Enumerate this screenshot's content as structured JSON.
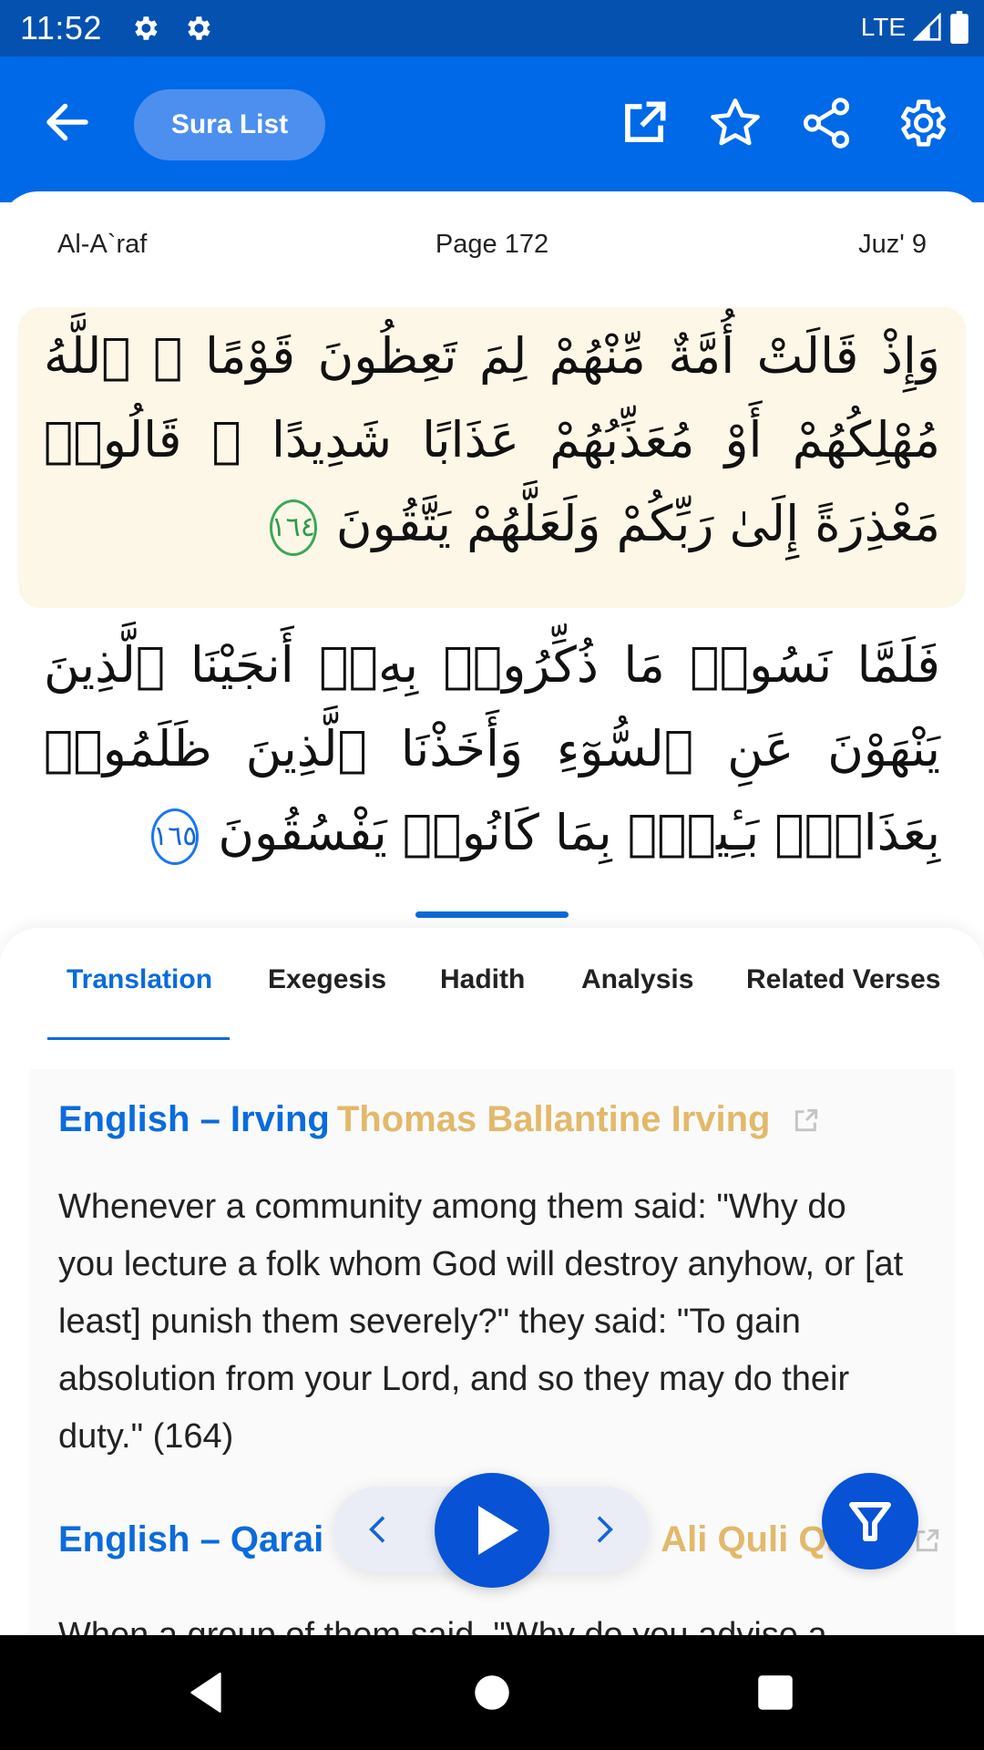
{
  "status_bar": {
    "time": "11:52",
    "network": "LTE",
    "icons": [
      "settings-gear-icon",
      "settings-gear-icon",
      "signal-icon",
      "battery-icon"
    ]
  },
  "app_bar": {
    "back_icon": "arrow-left-icon",
    "sura_list_label": "Sura List",
    "actions": [
      "open-external-icon",
      "star-icon",
      "share-icon",
      "settings-icon"
    ],
    "color": "#0069e8"
  },
  "reader": {
    "sura_name": "Al-A`raf",
    "page_label": "Page",
    "page_number": "172",
    "juz_label": "Juz' 9",
    "verses": [
      {
        "text": "وَإِذْ قَالَتْ أُمَّةٌ مِّنْهُمْ لِمَ تَعِظُونَ قَوْمًا ۙ ٱللَّهُ مُهْلِكُهُمْ أَوْ مُعَذِّبُهُمْ عَذَابًا شَدِيدًا ۖ قَالُوا۟ مَعْذِرَةً إِلَىٰ رَبِّكُمْ وَلَعَلَّهُمْ يَتَّقُونَ",
        "number": "١٦٤",
        "highlighted": true
      },
      {
        "text": "فَلَمَّا نَسُوا۟ مَا ذُكِّرُوا۟ بِهِۦٓ أَنجَيْنَا ٱلَّذِينَ يَنْهَوْنَ عَنِ ٱلسُّوٓءِ وَأَخَذْنَا ٱلَّذِينَ ظَلَمُوا۟ بِعَذَابٍۭ بَـِٔيسٍۭ بِمَا كَانُوا۟ يَفْسُقُونَ",
        "number": "١٦٥",
        "highlighted": false
      }
    ]
  },
  "tabs": [
    {
      "label": "Translation",
      "active": true
    },
    {
      "label": "Exegesis",
      "active": false
    },
    {
      "label": "Hadith",
      "active": false
    },
    {
      "label": "Analysis",
      "active": false
    },
    {
      "label": "Related Verses",
      "active": false
    }
  ],
  "translations": [
    {
      "language_label": "English – Irving",
      "translator": "Thomas Ballantine Irving",
      "text": "Whenever a community among them said: \"Why do you lecture a folk whom God will destroy anyhow, or [at least] punish them severely?\" they said: \"To gain absolution from your Lord, and so they may do their duty.\" (164)"
    },
    {
      "language_label": "English – Qarai",
      "translator": "Ali Quli Qarai",
      "text": "When a group of them said, \"Why do you advise a"
    }
  ],
  "player": {
    "prev_icon": "chevron-left-icon",
    "play_icon": "play-icon",
    "next_icon": "chevron-right-icon"
  },
  "filter_icon": "filter-icon",
  "nav_bar": [
    "back-triangle-icon",
    "home-circle-icon",
    "recents-square-icon"
  ]
}
